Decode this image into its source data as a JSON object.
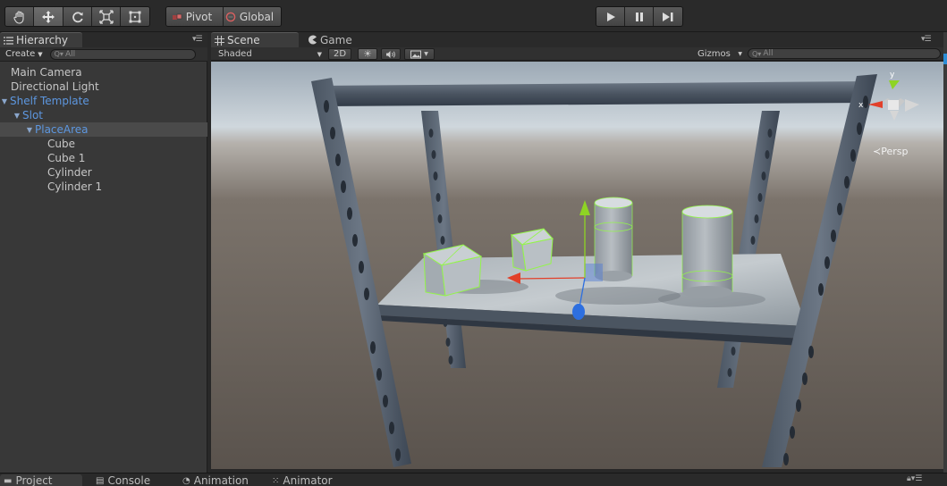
{
  "toolbar": {
    "tools": [
      "hand-tool",
      "move-tool",
      "rotate-tool",
      "scale-tool",
      "rect-tool"
    ],
    "active_tool": "move-tool",
    "pivot_label": "Pivot",
    "global_label": "Global",
    "playback": [
      "play",
      "pause",
      "step"
    ]
  },
  "hierarchy": {
    "tab_label": "Hierarchy",
    "create_label": "Create",
    "search_placeholder": "All",
    "items": [
      {
        "label": "Main Camera",
        "depth": 0,
        "expanded": null,
        "prefab": false
      },
      {
        "label": "Directional Light",
        "depth": 0,
        "expanded": null,
        "prefab": false
      },
      {
        "label": "Shelf Template",
        "depth": 0,
        "expanded": true,
        "prefab": true
      },
      {
        "label": "Slot",
        "depth": 1,
        "expanded": true,
        "prefab": true
      },
      {
        "label": "PlaceArea",
        "depth": 2,
        "expanded": true,
        "prefab": true,
        "highlighted": true
      },
      {
        "label": "Cube",
        "depth": 3,
        "expanded": null,
        "prefab": false
      },
      {
        "label": "Cube 1",
        "depth": 3,
        "expanded": null,
        "prefab": false
      },
      {
        "label": "Cylinder",
        "depth": 3,
        "expanded": null,
        "prefab": false
      },
      {
        "label": "Cylinder 1",
        "depth": 3,
        "expanded": null,
        "prefab": false
      }
    ]
  },
  "scene": {
    "tabs": [
      {
        "label": "Scene",
        "selected": true
      },
      {
        "label": "Game",
        "selected": false
      }
    ],
    "shading_mode": "Shaded",
    "mode_2d_label": "2D",
    "lighting_on": true,
    "gizmos_label": "Gizmos",
    "search_placeholder": "All",
    "orientation": {
      "x_label": "x",
      "y_label": "y",
      "projection_label": "Persp"
    }
  },
  "bottom_tabs": [
    {
      "label": "Project",
      "icon": "folder-icon",
      "selected": true
    },
    {
      "label": "Console",
      "icon": "console-icon",
      "selected": false
    },
    {
      "label": "Animation",
      "icon": "animation-icon",
      "selected": false
    },
    {
      "label": "Animator",
      "icon": "animator-icon",
      "selected": false
    }
  ],
  "colors": {
    "prefab_text": "#5d97e0",
    "axis_x": "#e2402a",
    "axis_y": "#8ed424",
    "axis_z": "#2d6fe0",
    "selection_outline": "#93f54a"
  }
}
